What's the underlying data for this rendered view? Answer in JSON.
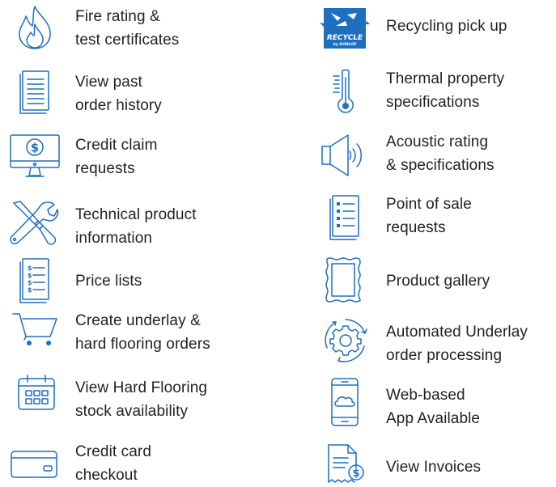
{
  "accent_color": "#1f6fc0",
  "left_column": [
    {
      "icon": "fire-icon",
      "lines": [
        "Fire rating &",
        "test certificates"
      ]
    },
    {
      "icon": "document-icon",
      "lines": [
        "View past",
        "order history"
      ]
    },
    {
      "icon": "monitor-dollar-icon",
      "lines": [
        "Credit claim",
        "requests"
      ]
    },
    {
      "icon": "tools-icon",
      "lines": [
        "Technical product",
        "information"
      ]
    },
    {
      "icon": "price-list-icon",
      "lines": [
        "Price lists"
      ]
    },
    {
      "icon": "shopping-cart-icon",
      "lines": [
        "Create underlay &",
        "hard flooring orders"
      ]
    },
    {
      "icon": "calendar-icon",
      "lines": [
        "View Hard Flooring",
        "stock availability"
      ]
    },
    {
      "icon": "credit-card-icon",
      "lines": [
        "Credit card",
        "checkout"
      ]
    }
  ],
  "right_column": [
    {
      "icon": "recycle-logo-icon",
      "lines": [
        "Recycling pick up"
      ],
      "logo_text": "RECYCLE",
      "logo_subtext": "by DUNLOP"
    },
    {
      "icon": "thermometer-icon",
      "lines": [
        "Thermal property",
        "specifications"
      ]
    },
    {
      "icon": "speaker-icon",
      "lines": [
        "Acoustic rating",
        "& specifications"
      ]
    },
    {
      "icon": "checklist-icon",
      "lines": [
        "Point of sale",
        "requests"
      ]
    },
    {
      "icon": "gallery-frame-icon",
      "lines": [
        "Product gallery"
      ]
    },
    {
      "icon": "gear-cycle-icon",
      "lines": [
        "Automated Underlay",
        "order processing"
      ]
    },
    {
      "icon": "mobile-cloud-icon",
      "lines": [
        "Web-based",
        "App Available"
      ]
    },
    {
      "icon": "invoice-icon",
      "lines": [
        "View Invoices"
      ]
    }
  ]
}
